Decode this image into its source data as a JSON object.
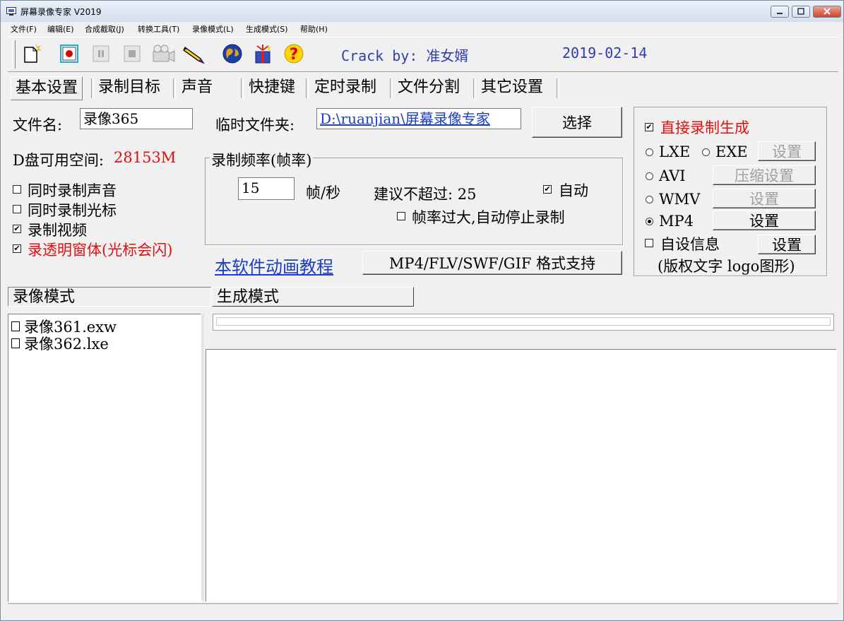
{
  "window": {
    "title": "屏幕录像专家 V2019"
  },
  "menu": [
    "文件(F)",
    "编辑(E)",
    "合成截取(J)",
    "转换工具(T)",
    "录像模式(L)",
    "生成模式(S)",
    "帮助(H)"
  ],
  "toolbar": {
    "icons": [
      "new-file-icon",
      "record-icon",
      "pause-icon",
      "stop-icon",
      "camera-icon",
      "pen-icon",
      "globe-icon",
      "gift-icon",
      "help-icon"
    ],
    "crack_text": "Crack by: 准女婿",
    "date": "2019-02-14"
  },
  "tabs": [
    "基本设置",
    "录制目标",
    "声音",
    "快捷键",
    "定时录制",
    "文件分割",
    "其它设置"
  ],
  "basic": {
    "filename_label": "文件名:",
    "filename_value": "录像365",
    "temp_folder_label": "临时文件夹:",
    "temp_folder_value": "D:\\ruanjian\\屏幕录像专家",
    "choose_button": "选择",
    "disk_space_label": "D盘可用空间:",
    "disk_space_value": "28153M",
    "framerate_group": "录制频率(帧率)",
    "fps_value": "15",
    "fps_unit": "帧/秒",
    "suggest_label": "建议不超过: 25",
    "auto_label": "自动",
    "auto_checked": true,
    "too_high_label": "帧率过大,自动停止录制",
    "too_high_checked": false,
    "options": [
      {
        "label": "同时录制声音",
        "checked": false
      },
      {
        "label": "同时录制光标",
        "checked": false
      },
      {
        "label": "录制视频",
        "checked": true
      },
      {
        "label": "录透明窗体(光标会闪)",
        "checked": true
      }
    ],
    "tutorial_link": "本软件动画教程",
    "format_button": "MP4/FLV/SWF/GIF  格式支持"
  },
  "output": {
    "direct_label": "直接录制生成",
    "direct_checked": true,
    "formats": [
      {
        "label": "LXE",
        "selected": false
      },
      {
        "label": "EXE",
        "selected": false
      },
      {
        "label": "AVI",
        "selected": false
      },
      {
        "label": "WMV",
        "selected": false
      },
      {
        "label": "MP4",
        "selected": true
      }
    ],
    "settings_label": "设置",
    "compress_settings_label": "压缩设置",
    "custom_info_label": "自设信息",
    "custom_info_checked": false,
    "custom_info_note": "(版权文字 logo图形)"
  },
  "bottom": {
    "mode_tabs": [
      "录像模式",
      "生成模式"
    ],
    "files": [
      "录像361.exw",
      "录像362.lxe"
    ]
  },
  "colors": {
    "accent_red": "#e01010",
    "link_blue": "#1a3fbf",
    "crack_blue": "#2f3fb0"
  }
}
